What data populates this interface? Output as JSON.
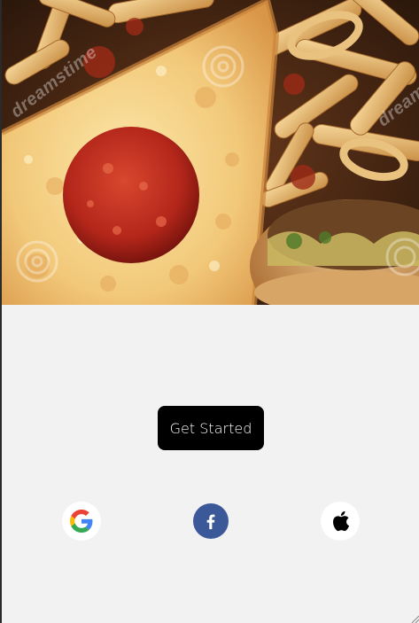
{
  "hero": {
    "image_alt": "Pizza slice with pepperoni, fries, onion rings and a burger",
    "watermark_text": "dreamstime"
  },
  "cta": {
    "label": "Get Started"
  },
  "social": {
    "google": {
      "icon": "google-icon"
    },
    "facebook": {
      "icon": "facebook-icon",
      "color": "#3b5998"
    },
    "apple": {
      "icon": "apple-icon"
    }
  },
  "colors": {
    "background": "#f2f2f2",
    "button": "#000000",
    "button_text": "#ffffff"
  }
}
